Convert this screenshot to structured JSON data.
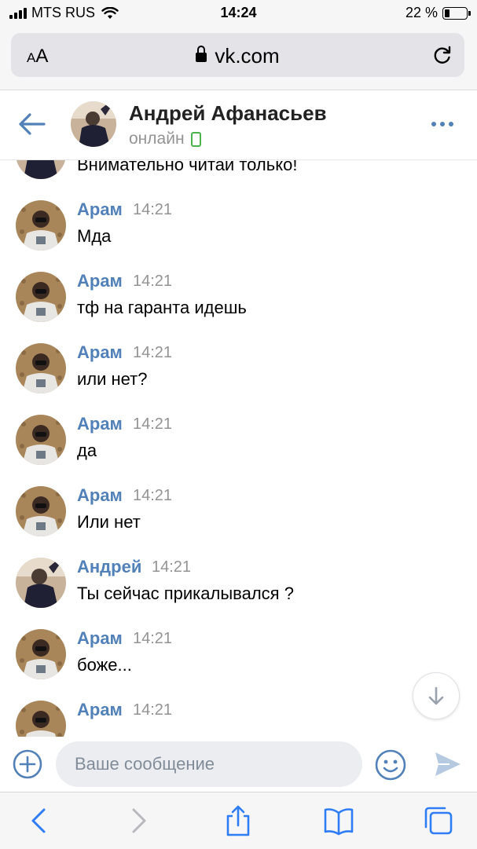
{
  "status_bar": {
    "carrier": "MTS RUS",
    "time": "14:24",
    "battery": "22 %",
    "battery_level": 0.22
  },
  "browser": {
    "text_size_label_small": "A",
    "text_size_label_large": "A",
    "url": "vk.com",
    "icons": [
      "lock-icon",
      "reload-icon"
    ]
  },
  "header": {
    "name": "Андрей Афанасьев",
    "status": "онлайн",
    "icons": [
      "back-arrow-icon",
      "mobile-online-icon",
      "more-icon"
    ]
  },
  "messages": [
    {
      "author": "",
      "time": "",
      "text": "Внимательно читай только!",
      "avatar": "andrey"
    },
    {
      "author": "Арам",
      "time": "14:21",
      "text": "Мда",
      "avatar": "aram"
    },
    {
      "author": "Арам",
      "time": "14:21",
      "text": "тф на гаранта идешь",
      "avatar": "aram"
    },
    {
      "author": "Арам",
      "time": "14:21",
      "text": "или нет?",
      "avatar": "aram"
    },
    {
      "author": "Арам",
      "time": "14:21",
      "text": "да",
      "avatar": "aram"
    },
    {
      "author": "Арам",
      "time": "14:21",
      "text": "Или нет",
      "avatar": "aram"
    },
    {
      "author": "Андрей",
      "time": "14:21",
      "text": "Ты сейчас прикалывался ?",
      "avatar": "andrey"
    },
    {
      "author": "Арам",
      "time": "14:21",
      "text": "боже...",
      "avatar": "aram"
    },
    {
      "author": "Арам",
      "time": "14:21",
      "text": "",
      "avatar": "aram"
    }
  ],
  "composer": {
    "placeholder": "Ваше сообщение",
    "value": ""
  },
  "colors": {
    "accent": "#5181b8",
    "online_green": "#4bb34b",
    "muted": "#939393",
    "input_bg": "#ebedf0"
  },
  "toolbar_icons": [
    "back-icon",
    "forward-icon",
    "share-icon",
    "bookmarks-icon",
    "tabs-icon"
  ]
}
